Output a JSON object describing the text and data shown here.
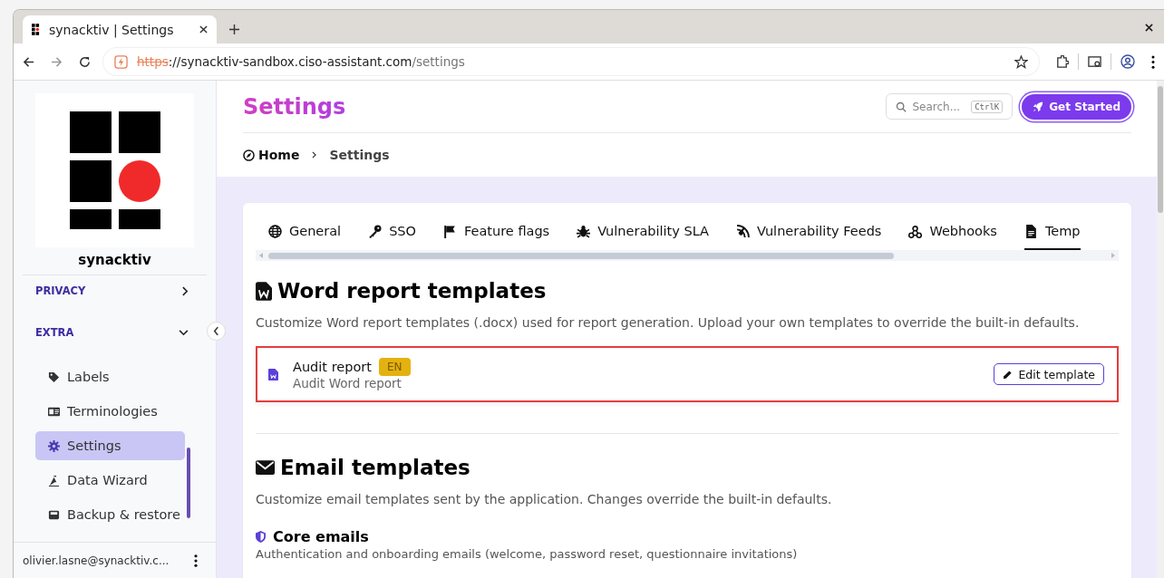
{
  "browser": {
    "tab_title": "synacktiv | Settings",
    "url_scheme": "https",
    "url_host": "://synacktiv-sandbox.ciso-assistant.com",
    "url_path": "/settings"
  },
  "sidebar": {
    "org_name": "synacktiv",
    "sections": [
      {
        "label": "PRIVACY",
        "expanded": false
      },
      {
        "label": "EXTRA",
        "expanded": true,
        "items": [
          {
            "label": "Labels",
            "selected": false
          },
          {
            "label": "Terminologies",
            "selected": false
          },
          {
            "label": "Settings",
            "selected": true
          },
          {
            "label": "Data Wizard",
            "selected": false
          },
          {
            "label": "Backup & restore",
            "selected": false
          }
        ]
      }
    ],
    "user": "olivier.lasne@synacktiv.c..."
  },
  "header": {
    "title": "Settings",
    "search_placeholder": "Search...",
    "search_shortcut": "CtrlK",
    "get_started": "Get Started",
    "breadcrumbs": [
      "Home",
      "Settings"
    ]
  },
  "tabs": [
    {
      "label": "General",
      "selected": false
    },
    {
      "label": "SSO",
      "selected": false
    },
    {
      "label": "Feature flags",
      "selected": false
    },
    {
      "label": "Vulnerability SLA",
      "selected": false
    },
    {
      "label": "Vulnerability Feeds",
      "selected": false
    },
    {
      "label": "Webhooks",
      "selected": false
    },
    {
      "label": "Temp",
      "selected": true
    }
  ],
  "word_section": {
    "title": "Word report templates",
    "description": "Customize Word report templates (.docx) used for report generation. Upload your own templates to override the built-in defaults.",
    "templates": [
      {
        "name": "Audit report",
        "lang": "EN",
        "subtitle": "Audit Word report",
        "action": "Edit template",
        "highlighted": true
      }
    ]
  },
  "email_section": {
    "title": "Email templates",
    "description": "Customize email templates sent by the application. Changes override the built-in defaults.",
    "group_title": "Core emails",
    "group_description": "Authentication and onboarding emails (welcome, password reset, questionnaire invitations)"
  }
}
